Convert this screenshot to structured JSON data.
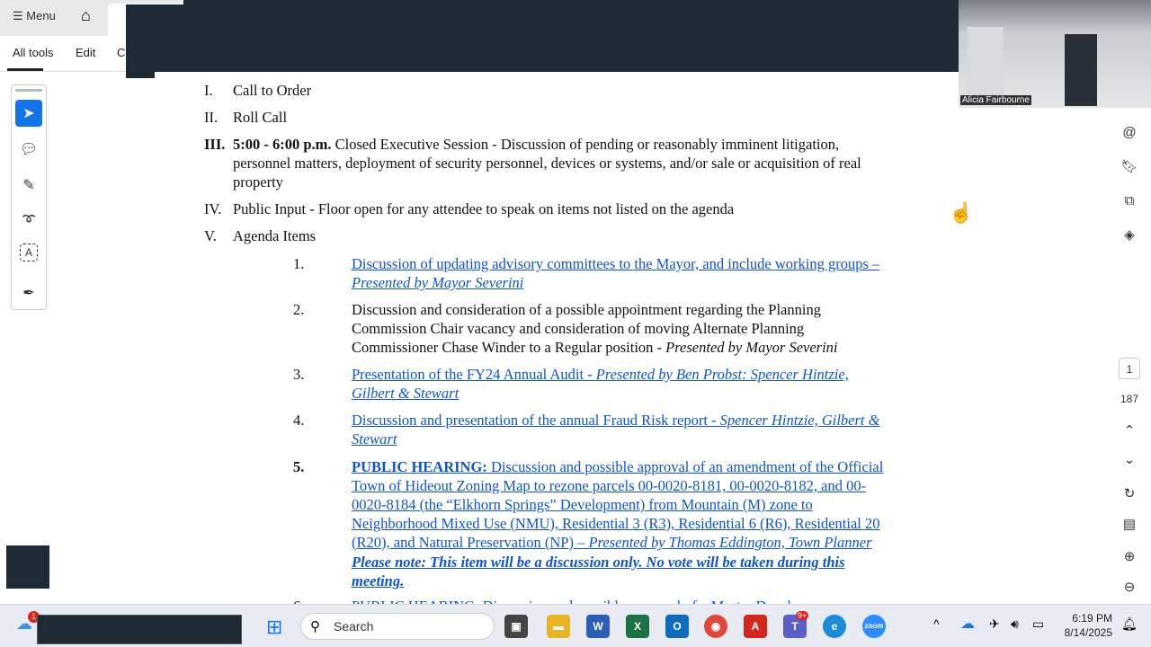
{
  "toolbar": {
    "menu": "Menu",
    "tabs": [
      "All tools",
      "Edit",
      "Convert"
    ]
  },
  "video": {
    "participant": "Alicia Fairbourne"
  },
  "agenda": {
    "items": [
      {
        "num": "I.",
        "text": "Call to Order"
      },
      {
        "num": "II.",
        "text": "Roll Call"
      },
      {
        "num": "III.",
        "bold": "5:00 - 6:00 p.m.",
        "line1": " Closed Executive Session - Discussion of pending or reasonably imminent litigation,",
        "line2": "personnel matters, deployment of security personnel, devices or systems, and/or sale or acquisition of real",
        "line3": "property"
      },
      {
        "num": "IV.",
        "text": "Public Input - Floor open for any attendee to speak on items not listed on the agenda"
      },
      {
        "num": "V.",
        "text": "Agenda Items"
      }
    ],
    "sub": [
      {
        "num": "1.",
        "l1": "Discussion of updating advisory committees to the Mayor, and include working groups –",
        "l2": "Presented by Mayor Severini"
      },
      {
        "num": "2.",
        "l1": "Discussion and consideration of a possible appointment regarding the Planning",
        "l2": "Commission Chair vacancy and consideration of moving Alternate Planning",
        "l3a": "Commissioner Chase Winder to a Regular position - ",
        "l3b": "Presented by Mayor Severini"
      },
      {
        "num": "3.",
        "l1a": "Presentation of the FY24 Annual Audit - ",
        "l1b": "Presented by Ben Probst: Spencer Hintzie,",
        "l2": "Gilbert & Stewart"
      },
      {
        "num": "4.",
        "l1a": "Discussion and presentation of the annual Fraud Risk report - ",
        "l1b": "Spencer Hintzie, Gilbert &",
        "l2": "Stewart"
      },
      {
        "num": "5.",
        "bold": "PUBLIC HEARING:",
        "l1": " Discussion and possible approval of an amendment of the Official",
        "l2": "Town of Hideout Zoning Map to rezone parcels 00-0020-8181, 00-0020-8182, and 00-",
        "l3": "0020-8184 (the “Elkhorn Springs” Development) from Mountain (M) zone to",
        "l4": "Neighborhood Mixed Use (NMU), Residential 3 (R3), Residential 6 (R6), Residential 20",
        "l5a": "(R20), and Natural Preservation (NP) – ",
        "l5b": "Presented by Thomas Eddington, Town Planner",
        "note1": "Please note: This item will be a discussion only. No vote will be taken during this",
        "note2": "meeting."
      },
      {
        "num": "6.",
        "l1": "PUBLIC HEARING: Discussion and possible approval of a Master Develo..."
      }
    ]
  },
  "page": {
    "current": "1",
    "total": "187"
  },
  "taskbar": {
    "search": "Search",
    "badge": "1",
    "teams_badge": "9+",
    "time": "6:19 PM",
    "date": "8/14/2025"
  }
}
